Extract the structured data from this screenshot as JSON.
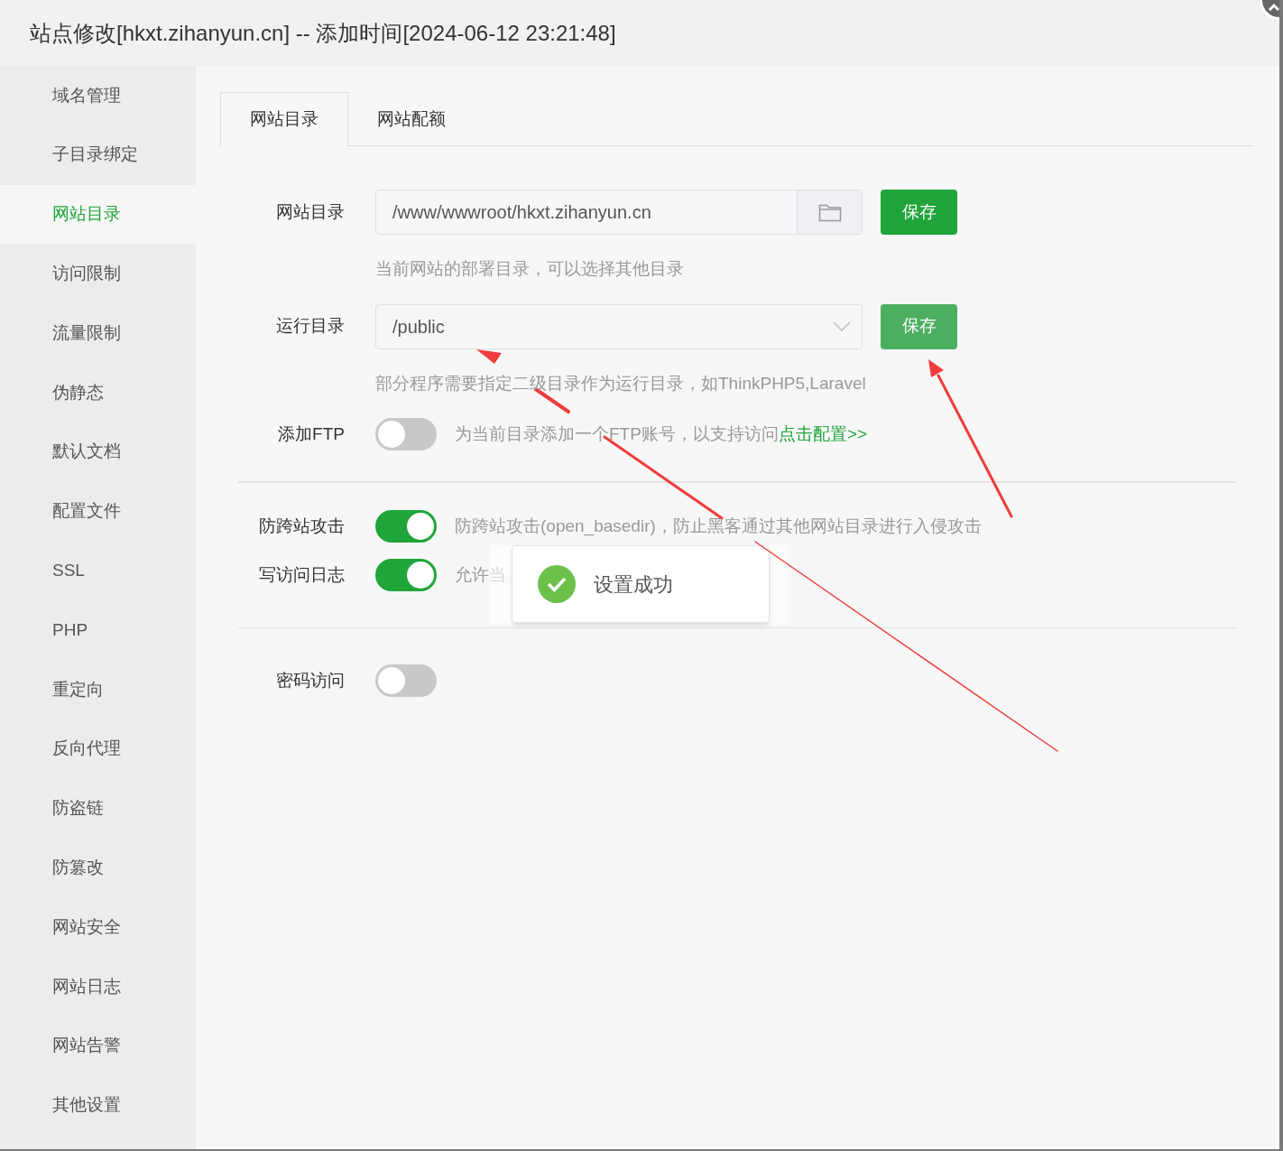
{
  "window": {
    "title": "站点修改[hkxt.zihanyun.cn] -- 添加时间[2024-06-12 23:21:48]"
  },
  "sidebar": {
    "items": [
      {
        "label": "域名管理",
        "selected": false
      },
      {
        "label": "子目录绑定",
        "selected": false
      },
      {
        "label": "网站目录",
        "selected": true
      },
      {
        "label": "访问限制",
        "selected": false
      },
      {
        "label": "流量限制",
        "selected": false
      },
      {
        "label": "伪静态",
        "selected": false
      },
      {
        "label": "默认文档",
        "selected": false
      },
      {
        "label": "配置文件",
        "selected": false
      },
      {
        "label": "SSL",
        "selected": false
      },
      {
        "label": "PHP",
        "selected": false
      },
      {
        "label": "重定向",
        "selected": false
      },
      {
        "label": "反向代理",
        "selected": false
      },
      {
        "label": "防盗链",
        "selected": false
      },
      {
        "label": "防篡改",
        "selected": false
      },
      {
        "label": "网站安全",
        "selected": false
      },
      {
        "label": "网站日志",
        "selected": false
      },
      {
        "label": "网站告警",
        "selected": false
      },
      {
        "label": "其他设置",
        "selected": false
      }
    ]
  },
  "tabs": [
    {
      "label": "网站目录",
      "selected": true
    },
    {
      "label": "网站配额",
      "selected": false
    }
  ],
  "sections": [
    {
      "rows": [
        {
          "kind": "path",
          "label": "网站目录",
          "value": "/www/wwwroot/hkxt.zihanyun.cn",
          "button": "保存",
          "hint": "当前网站的部署目录，可以选择其他目录"
        },
        {
          "kind": "select",
          "label": "运行目录",
          "value": "/public",
          "button": "保存",
          "hint": "部分程序需要指定二级目录作为运行目录，如ThinkPHP5,Laravel"
        },
        {
          "kind": "toggle",
          "label": "添加FTP",
          "on": false,
          "description": "为当前目录添加一个FTP账号，以支持访问",
          "link": "点击配置>>"
        }
      ]
    },
    {
      "rows": [
        {
          "kind": "toggle",
          "label": "防跨站攻击",
          "on": true,
          "description": "防跨站攻击(open_basedir)，防止黑客通过其他网站目录进行入侵攻击"
        },
        {
          "kind": "toggle",
          "label": "写访问日志",
          "on": true,
          "description": "允许当"
        }
      ]
    },
    {
      "rows": [
        {
          "kind": "toggle",
          "label": "密码访问",
          "on": false
        }
      ]
    }
  ],
  "toast": {
    "message": "设置成功"
  }
}
